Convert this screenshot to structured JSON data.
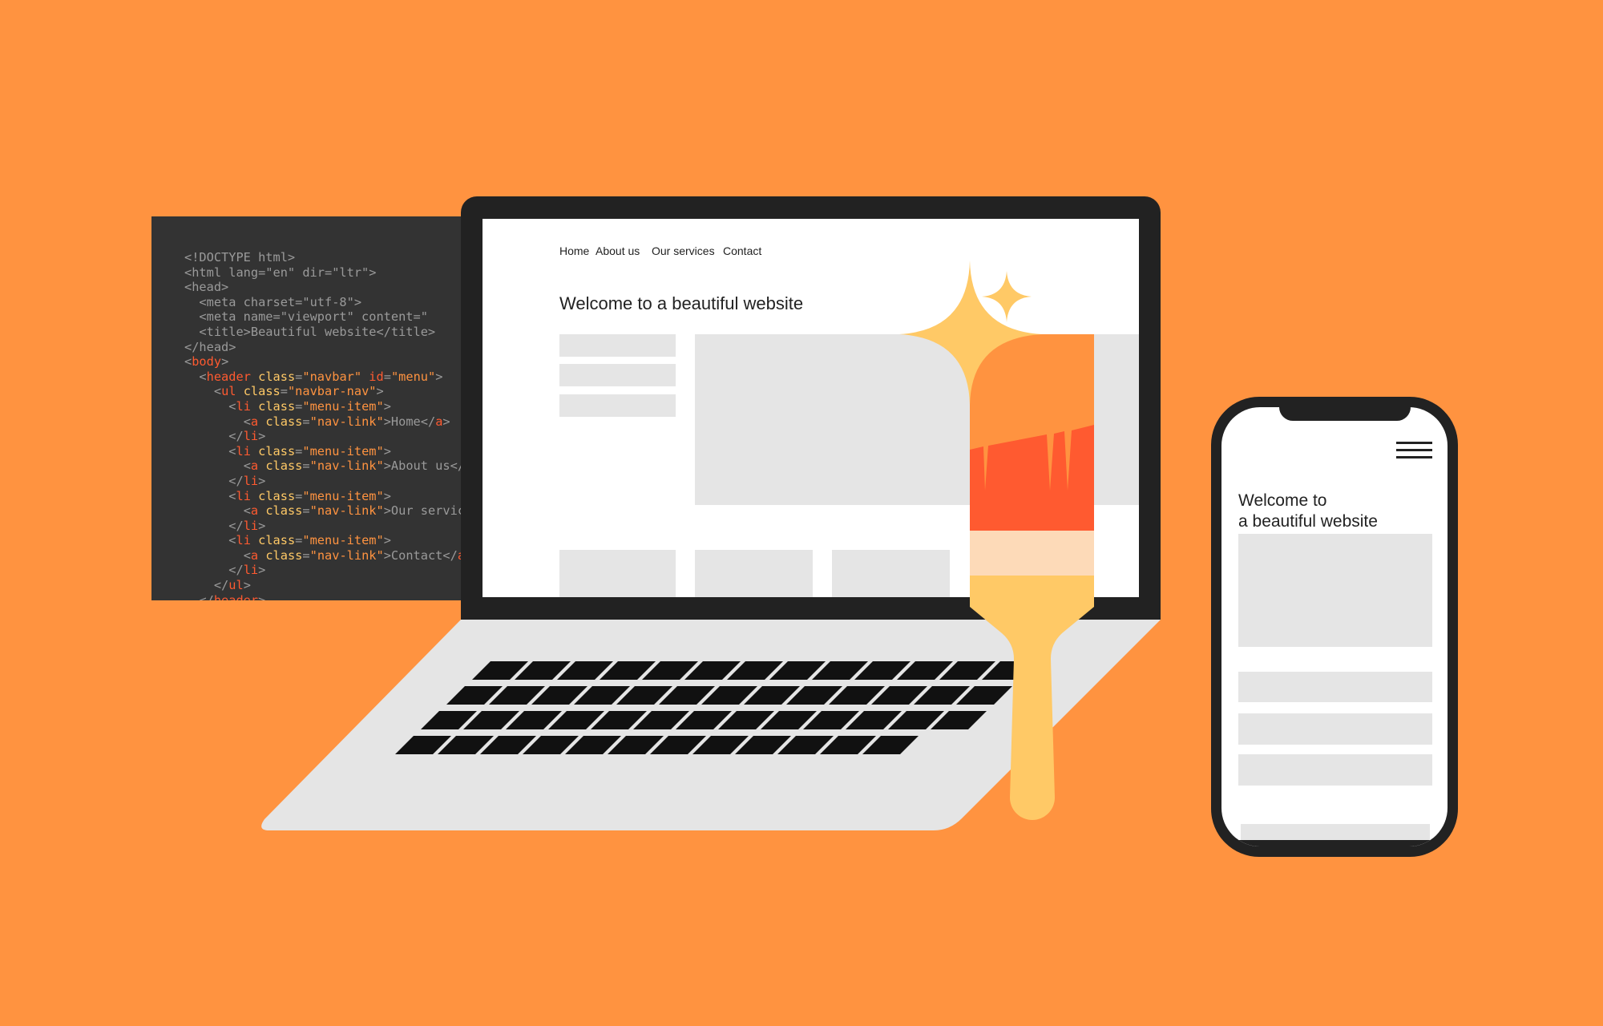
{
  "code": {
    "lines": [
      {
        "indent": 0,
        "tokens": [
          [
            "<!DOCTYPE html>",
            "p"
          ]
        ]
      },
      {
        "indent": 0,
        "tokens": [
          [
            "<html lang=\"en\" dir=\"ltr\">",
            "p"
          ]
        ]
      },
      {
        "indent": 0,
        "tokens": [
          [
            "<head>",
            "p"
          ]
        ]
      },
      {
        "indent": 1,
        "tokens": [
          [
            "<meta charset=\"utf-8\">",
            "p"
          ]
        ]
      },
      {
        "indent": 1,
        "tokens": [
          [
            "<meta name=\"viewport\" content=\"",
            "p"
          ]
        ]
      },
      {
        "indent": 1,
        "tokens": [
          [
            "<title>Beautiful website</title>",
            "p"
          ]
        ]
      },
      {
        "indent": 0,
        "tokens": [
          [
            "</head>",
            "p"
          ]
        ]
      },
      {
        "indent": 0,
        "tokens": [
          [
            "<",
            "p"
          ],
          [
            "body",
            "tag"
          ],
          [
            ">",
            "p"
          ]
        ]
      },
      {
        "indent": 1,
        "tokens": [
          [
            "<",
            "p"
          ],
          [
            "header",
            "tag"
          ],
          [
            " class",
            "attr"
          ],
          [
            "=",
            "p"
          ],
          [
            "\"navbar\"",
            "val"
          ],
          [
            " id",
            "tag"
          ],
          [
            "=",
            "p"
          ],
          [
            "\"menu\"",
            "val"
          ],
          [
            ">",
            "p"
          ]
        ]
      },
      {
        "indent": 2,
        "tokens": [
          [
            "<",
            "p"
          ],
          [
            "ul",
            "tag"
          ],
          [
            " class",
            "attr"
          ],
          [
            "=",
            "p"
          ],
          [
            "\"navbar-nav\"",
            "val"
          ],
          [
            ">",
            "p"
          ]
        ]
      },
      {
        "indent": 3,
        "tokens": [
          [
            "<",
            "p"
          ],
          [
            "li",
            "tag"
          ],
          [
            " class",
            "attr"
          ],
          [
            "=",
            "p"
          ],
          [
            "\"menu-item\"",
            "val"
          ],
          [
            ">",
            "p"
          ]
        ]
      },
      {
        "indent": 4,
        "tokens": [
          [
            "<",
            "p"
          ],
          [
            "a",
            "tag"
          ],
          [
            " class",
            "attr"
          ],
          [
            "=",
            "p"
          ],
          [
            "\"nav-link\"",
            "val"
          ],
          [
            ">Home</",
            "p"
          ],
          [
            "a",
            "tag"
          ],
          [
            ">",
            "p"
          ]
        ]
      },
      {
        "indent": 3,
        "tokens": [
          [
            "</",
            "p"
          ],
          [
            "li",
            "tag"
          ],
          [
            ">",
            "p"
          ]
        ]
      },
      {
        "indent": 3,
        "tokens": [
          [
            "<",
            "p"
          ],
          [
            "li",
            "tag"
          ],
          [
            " class",
            "attr"
          ],
          [
            "=",
            "p"
          ],
          [
            "\"menu-item\"",
            "val"
          ],
          [
            ">",
            "p"
          ]
        ]
      },
      {
        "indent": 4,
        "tokens": [
          [
            "<",
            "p"
          ],
          [
            "a",
            "tag"
          ],
          [
            " class",
            "attr"
          ],
          [
            "=",
            "p"
          ],
          [
            "\"nav-link\"",
            "val"
          ],
          [
            ">About us</",
            "p"
          ],
          [
            "a",
            "tag"
          ],
          [
            ">",
            "p"
          ]
        ]
      },
      {
        "indent": 3,
        "tokens": [
          [
            "</",
            "p"
          ],
          [
            "li",
            "tag"
          ],
          [
            ">",
            "p"
          ]
        ]
      },
      {
        "indent": 3,
        "tokens": [
          [
            "<",
            "p"
          ],
          [
            "li",
            "tag"
          ],
          [
            " class",
            "attr"
          ],
          [
            "=",
            "p"
          ],
          [
            "\"menu-item\"",
            "val"
          ],
          [
            ">",
            "p"
          ]
        ]
      },
      {
        "indent": 4,
        "tokens": [
          [
            "<",
            "p"
          ],
          [
            "a",
            "tag"
          ],
          [
            " class",
            "attr"
          ],
          [
            "=",
            "p"
          ],
          [
            "\"nav-link\"",
            "val"
          ],
          [
            ">Our services</",
            "p"
          ],
          [
            "a",
            "tag"
          ],
          [
            ">",
            "p"
          ]
        ]
      },
      {
        "indent": 3,
        "tokens": [
          [
            "</",
            "p"
          ],
          [
            "li",
            "tag"
          ],
          [
            ">",
            "p"
          ]
        ]
      },
      {
        "indent": 3,
        "tokens": [
          [
            "<",
            "p"
          ],
          [
            "li",
            "tag"
          ],
          [
            " class",
            "attr"
          ],
          [
            "=",
            "p"
          ],
          [
            "\"menu-item\"",
            "val"
          ],
          [
            ">",
            "p"
          ]
        ]
      },
      {
        "indent": 4,
        "tokens": [
          [
            "<",
            "p"
          ],
          [
            "a",
            "tag"
          ],
          [
            " class",
            "attr"
          ],
          [
            "=",
            "p"
          ],
          [
            "\"nav-link\"",
            "val"
          ],
          [
            ">Contact</",
            "p"
          ],
          [
            "a",
            "tag"
          ],
          [
            ">",
            "p"
          ]
        ]
      },
      {
        "indent": 3,
        "tokens": [
          [
            "</",
            "p"
          ],
          [
            "li",
            "tag"
          ],
          [
            ">",
            "p"
          ]
        ]
      },
      {
        "indent": 2,
        "tokens": [
          [
            "</",
            "p"
          ],
          [
            "ul",
            "tag"
          ],
          [
            ">",
            "p"
          ]
        ]
      },
      {
        "indent": 1,
        "tokens": [
          [
            "</",
            "p"
          ],
          [
            "header",
            "tag"
          ],
          [
            ">",
            "p"
          ]
        ]
      }
    ]
  },
  "laptop_site": {
    "nav": [
      "Home",
      "About us",
      "Our services",
      "Contact"
    ],
    "heading": "Welcome to a beautiful website"
  },
  "phone_site": {
    "title_line1": "Welcome to",
    "title_line2": "a beautiful website",
    "menu_icon": "hamburger-menu-icon"
  },
  "colors": {
    "background": "#FF9340",
    "code_panel": "#333333",
    "device": "#222222",
    "placeholder": "#E5E5E5",
    "brush_red": "#FF5A30",
    "brush_yellow": "#FFC966",
    "brush_peach": "#FDDAB8"
  }
}
